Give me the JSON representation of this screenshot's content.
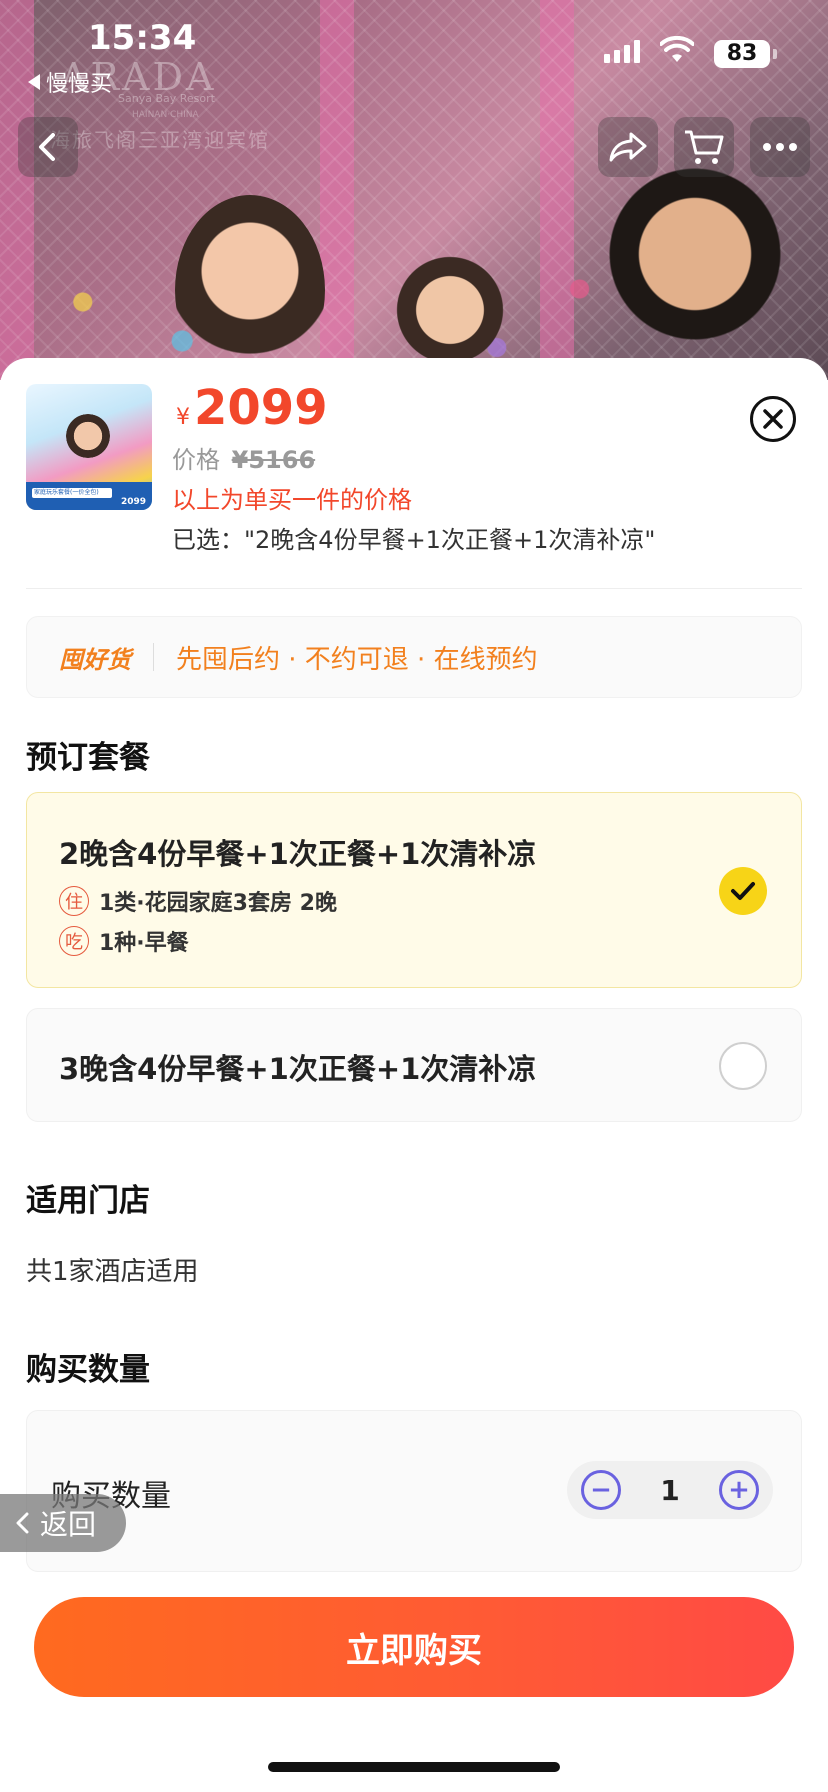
{
  "status_bar": {
    "time": "15:34",
    "back_app": "慢慢买",
    "battery": "83"
  },
  "hero": {
    "watermark": "ARADA",
    "watermark_sub1": "Sanya Bay Resort",
    "watermark_sub2": "HAINAN·CHINA",
    "watermark_cn": "海旅飞阁三亚湾迎宾馆"
  },
  "product": {
    "thumb_band_label": "家庭玩乐套餐(一价全包)",
    "thumb_band_price": "2099",
    "currency": "¥",
    "price": "2099",
    "orig_label": "价格",
    "orig_price": "¥5166",
    "note": "以上为单买一件的价格",
    "selected_text": "已选：\"2晚含4份早餐+1次正餐+1次清补凉\""
  },
  "promo": {
    "brand": "囤好货",
    "desc": "先囤后约 · 不约可退 · 在线预约"
  },
  "packages": {
    "title": "预订套餐",
    "items": [
      {
        "title": "2晚含4份早餐+1次正餐+1次清补凉",
        "stay_tag": "住",
        "stay": "1类·花园家庭3套房 2晚",
        "food_tag": "吃",
        "food": "1种·早餐",
        "selected": true
      },
      {
        "title": "3晚含4份早餐+1次正餐+1次清补凉",
        "selected": false
      }
    ]
  },
  "stores": {
    "title": "适用门店",
    "text": "共1家酒店适用"
  },
  "quantity": {
    "title": "购买数量",
    "label": "购买数量",
    "value": "1",
    "minus": "−",
    "plus": "+"
  },
  "float_back": {
    "label": "返回"
  },
  "buy_button": {
    "label": "立即购买"
  },
  "colors": {
    "accent": "#f2472b",
    "promo": "#f2801e",
    "check": "#f7d417",
    "stepper": "#6a62e0"
  }
}
